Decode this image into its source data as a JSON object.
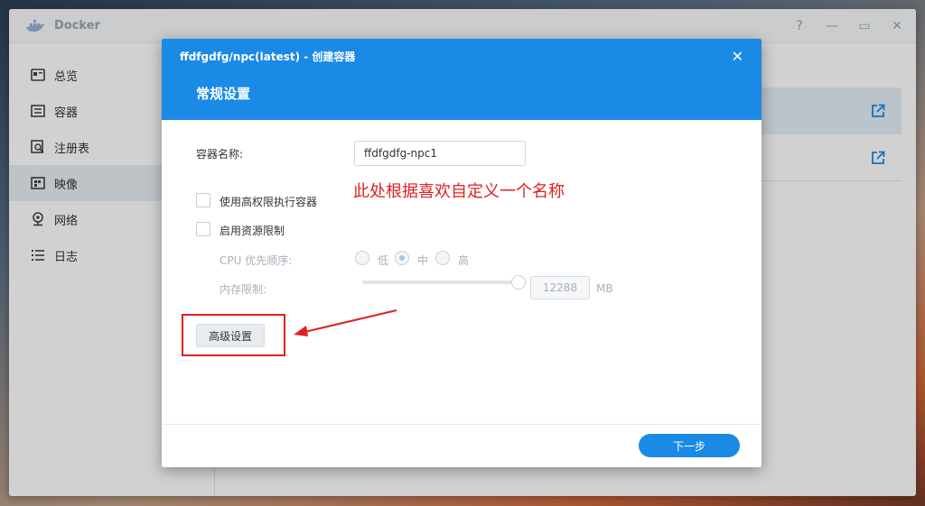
{
  "window": {
    "title": "Docker",
    "controls": [
      "?",
      "—",
      "▭",
      "✕"
    ]
  },
  "sidebar": {
    "items": [
      {
        "label": "总览",
        "icon": "overview-icon"
      },
      {
        "label": "容器",
        "icon": "container-icon"
      },
      {
        "label": "注册表",
        "icon": "registry-icon"
      },
      {
        "label": "映像",
        "icon": "image-icon",
        "active": true
      },
      {
        "label": "网络",
        "icon": "network-icon"
      },
      {
        "label": "日志",
        "icon": "log-icon"
      }
    ]
  },
  "dialog": {
    "title": "ffdfgdfg/npc(latest) - 创建容器",
    "close": "✕",
    "section": "常规设置",
    "container_name_label": "容器名称:",
    "container_name_value": "ffdfgdfg-npc1",
    "annotation": "此处根据喜欢自定义一个名称",
    "privileged_label": "使用高权限执行容器",
    "resource_limit_label": "启用资源限制",
    "cpu_priority_label": "CPU 优先顺序:",
    "cpu_low": "低",
    "cpu_mid": "中",
    "cpu_high": "高",
    "memory_label": "内存限制:",
    "memory_value": "12288",
    "memory_unit": "MB",
    "advanced_button": "高级设置",
    "next_button": "下一步"
  },
  "colors": {
    "accent": "#1a8ae6",
    "annotation": "#e02020"
  }
}
